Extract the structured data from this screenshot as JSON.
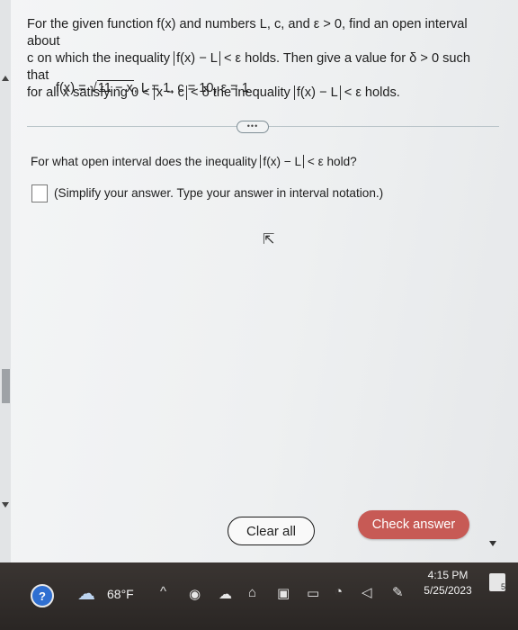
{
  "problem": {
    "line1_prefix": "For the given function f(x) and numbers L, c, and ε > 0, find an open interval about",
    "line2_prefix": "c on which the inequality",
    "line2_abs": "f(x) − L",
    "line2_suffix": "< ε holds. Then give a value for δ > 0 such that",
    "line3_prefix": "for all x satisfying 0 <",
    "line3_abs1": "x − c",
    "line3_mid": "< δ the inequality",
    "line3_abs2": "f(x) − L",
    "line3_suffix": "< ε holds."
  },
  "formula": {
    "lhs": "f(x) = ",
    "radical": "√",
    "radicand": "11 − x",
    "rest": ", L = 1, c = 10, ε = 1"
  },
  "divider": {
    "more_label": "•••"
  },
  "question": {
    "prefix": "For what open interval does the inequality",
    "abs": "f(x) − L",
    "suffix": "< ε hold?"
  },
  "answer": {
    "value": ""
  },
  "hint": "(Simplify your answer. Type your answer in interval notation.)",
  "buttons": {
    "clear": "Clear all",
    "check": "Check answer"
  },
  "taskbar": {
    "help": "?",
    "temperature": "68°F",
    "chevron": "^",
    "time": "4:15 PM",
    "date": "5/25/2023",
    "notification_count": "5"
  },
  "colors": {
    "check_button": "#c75a55",
    "taskbar": "#2a2624",
    "help_icon": "#2f6fd1"
  }
}
